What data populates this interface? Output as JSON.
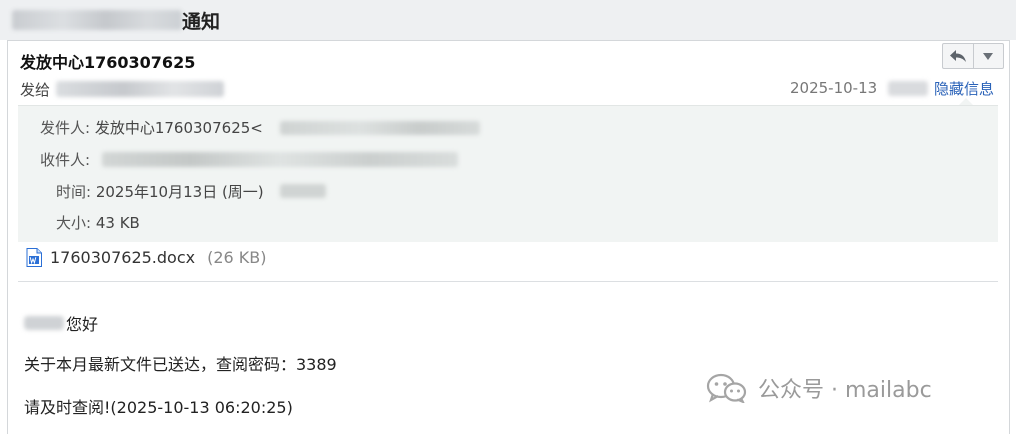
{
  "header": {
    "subject_suffix": "通知"
  },
  "message": {
    "title": "发放中心1760307625",
    "to_label": "发给",
    "date_short": "2025-10-13",
    "hide_details": "隐藏信息",
    "actions": {
      "reply_icon": "reply-icon",
      "more_icon": "chevron-down-icon"
    }
  },
  "details": {
    "from_label": "发件人:",
    "from_value": "发放中心1760307625<",
    "to_label": "收件人:",
    "time_label": "时间:",
    "time_value": "2025年10月13日 (周一)",
    "size_label": "大小:",
    "size_value": "43 KB"
  },
  "attachment": {
    "icon": "word-document-icon",
    "name": "1760307625.docx",
    "size": "(26 KB)"
  },
  "body": {
    "greeting": "您好",
    "line1": "关于本月最新文件已送达，查阅密码：3389",
    "line2": "请及时查阅!(2025-10-13 06:20:25)"
  },
  "watermark": {
    "text": "公众号 · mailabc"
  },
  "colors": {
    "link": "#2a62b8",
    "detail_bg": "#f1f4f3",
    "topbar_bg": "#eef0f2"
  }
}
